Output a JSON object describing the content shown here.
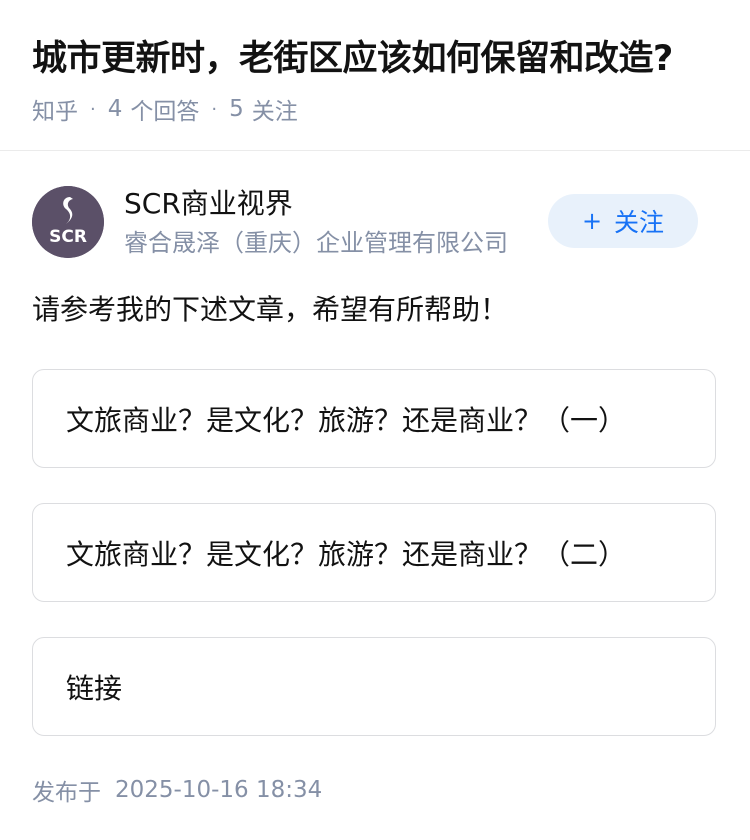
{
  "question": {
    "title": "城市更新时，老街区应该如何保留和改造?",
    "source": "知乎",
    "answer_count": "4",
    "answer_label": "个回答",
    "follower_count": "5",
    "follower_label": "关注"
  },
  "author": {
    "avatar_text": "SCR",
    "name": "SCR商业视界",
    "headline": "睿合晟泽（重庆）企业管理有限公司",
    "follow_label": "关注",
    "follow_icon": "plus-icon"
  },
  "answer": {
    "intro": "请参考我的下述文章，希望有所帮助！",
    "links": [
      {
        "title": "文旅商业？是文化？旅游？还是商业？（一）"
      },
      {
        "title": "文旅商业？是文化？旅游？还是商业？（二）"
      },
      {
        "title": "链接"
      }
    ],
    "published_label": "发布于",
    "published_time": "2025-10-16 18:34"
  },
  "colors": {
    "meta_gray": "#8590a6",
    "accent_blue": "#1772f6",
    "follow_bg": "#e8f1fb",
    "card_border": "#dcdde0",
    "avatar_bg": "#5b5068"
  }
}
